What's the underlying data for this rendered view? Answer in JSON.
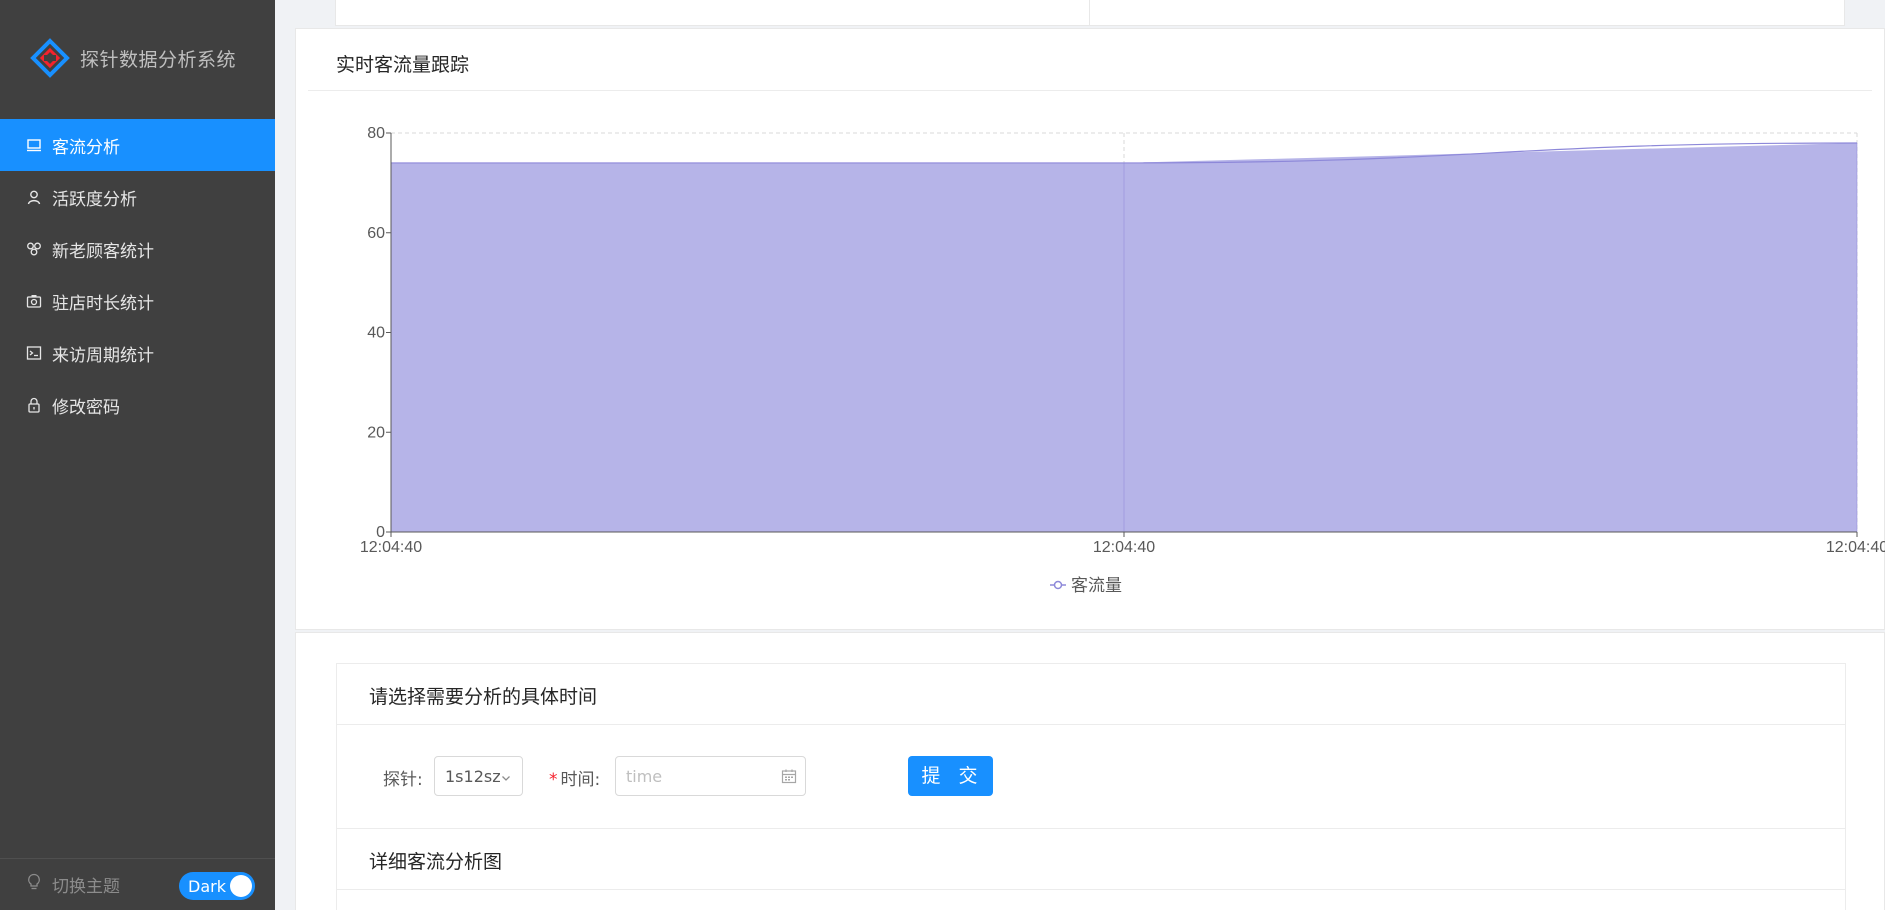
{
  "app": {
    "title": "探针数据分析系统"
  },
  "sidebar": {
    "items": [
      {
        "label": "客流分析",
        "icon": "monitor-icon",
        "active": true
      },
      {
        "label": "活跃度分析",
        "icon": "user-icon",
        "active": false
      },
      {
        "label": "新老顾客统计",
        "icon": "cluster-icon",
        "active": false
      },
      {
        "label": "驻店时长统计",
        "icon": "camera-icon",
        "active": false
      },
      {
        "label": "来访周期统计",
        "icon": "terminal-icon",
        "active": false
      },
      {
        "label": "修改密码",
        "icon": "lock-icon",
        "active": false
      }
    ],
    "theme": {
      "label": "切换主题",
      "toggle_label": "Dark",
      "icon": "bulb-icon"
    }
  },
  "realtime": {
    "title": "实时客流量跟踪"
  },
  "chart_data": {
    "type": "area",
    "categories": [
      "12:04:40",
      "12:04:40",
      "12:04:40"
    ],
    "series": [
      {
        "name": "客流量",
        "values": [
          74,
          74,
          78
        ],
        "color": "#b6b4e8",
        "line_color": "#8d88d9"
      }
    ],
    "yticks": [
      0,
      20,
      40,
      60,
      80
    ],
    "ylim": [
      0,
      80
    ],
    "grid": true,
    "legend_placement": "bottom-center"
  },
  "form": {
    "title": "请选择需要分析的具体时间",
    "probe_label": "探针:",
    "probe_value": "1s12sz",
    "time_required_mark": "*",
    "time_label": "时间:",
    "time_placeholder": "time",
    "submit_label": "提 交"
  },
  "detail": {
    "title": "详细客流分析图"
  },
  "colors": {
    "accent": "#1890ff",
    "sidebar_bg": "#404040"
  }
}
